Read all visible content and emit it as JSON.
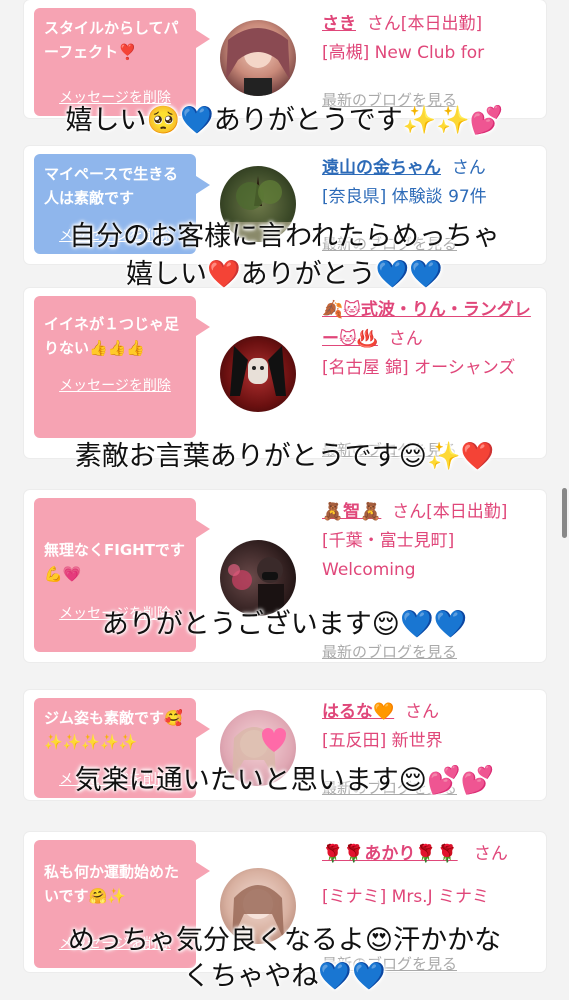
{
  "cards": [
    {
      "bubble": "スタイルからしてパーフェクト❣️",
      "delete": "メッセージを削除",
      "name": "さき",
      "san": "さん[本日出勤]",
      "location": "[高槻] New Club for",
      "blog": "最新のブログを見る",
      "bubble_color": "#f6a3b3"
    },
    {
      "bubble": "マイペースで生きる人は素敵です",
      "delete": "メッセージを削除",
      "name": "遠山の金ちゃん",
      "san": "さん",
      "location": "[奈良県] 体験談 97件",
      "blog": "最新のブログを見る",
      "bubble_color": "#8fb6ec"
    },
    {
      "bubble": "イイネが１つじゃ足りない👍👍👍",
      "delete": "メッセージを削除",
      "name": "🍂🐱式波・りん・ラングレー🐱♨️",
      "san": "さん",
      "location": "[名古屋 錦] オーシャンズ",
      "blog": "最新のブログを見る",
      "bubble_color": "#f6a3b3"
    },
    {
      "bubble": "無理なくFIGHTです💪💗",
      "delete": "メッセージを削除",
      "name": "🧸智🧸",
      "san": "さん[本日出勤]",
      "location": "[千葉・富士見町] Welcoming",
      "blog": "最新のブログを見る",
      "bubble_color": "#f6a3b3"
    },
    {
      "bubble": "ジム姿も素敵です🥰✨✨✨✨✨",
      "delete": "メッセージを削除",
      "name": "はるな🧡",
      "san": "さん",
      "location": "[五反田] 新世界",
      "blog": "最新のブログを見る",
      "bubble_color": "#f6a3b3"
    },
    {
      "bubble": "私も何か運動始めたいです🤗✨",
      "delete": "メッセージを削除",
      "name": "🌹🌹あかり🌹🌹",
      "san": "さん",
      "location": "[ミナミ] Mrs.J ミナミ",
      "blog": "最新のブログを見る",
      "bubble_color": "#f6a3b3"
    }
  ],
  "overlays": [
    "嬉しい🥺💙ありがとうです✨✨💕",
    "自分のお客様に言われたらめっちゃ",
    "嬉しい❤️ありがとう💙💙",
    "素敵お言葉ありがとうです😌✨❤️",
    "ありがとうございます😌💙💙",
    "気楽に通いたいと思います😌💕💕",
    "めっちゃ気分良くなるよ😍汗かかな",
    "くちゃやね💙💙"
  ]
}
